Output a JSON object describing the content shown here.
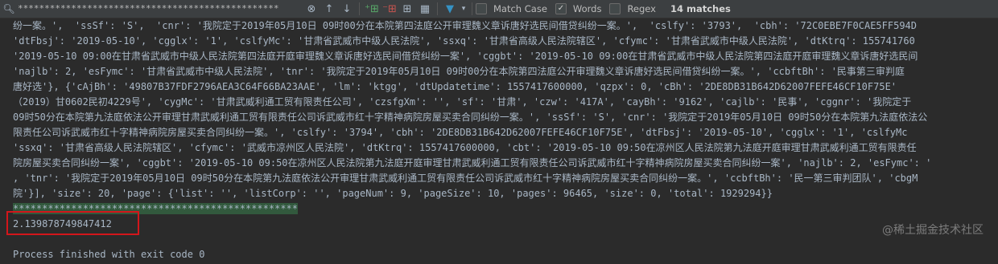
{
  "find_bar": {
    "query": "*************************************************",
    "options": [
      {
        "label": "Match Case",
        "checked": false
      },
      {
        "label": "Words",
        "checked": true
      },
      {
        "label": "Regex",
        "checked": false
      }
    ],
    "match_count": "14 matches"
  },
  "console": {
    "lines": [
      "纷一案。',  'ssSf': 'S',  'cnr': '我院定于2019年05月10日 09时00分在本院第四法庭公开审理魏义章诉唐好选民间借贷纠纷一案。',  'cslfy': '3793',  'cbh': '72C0EBE7F0CAE5FF594D",
      "'dtFbsj': '2019-05-10', 'cgglx': '1', 'cslfyMc': '甘肃省武威市中级人民法院', 'ssxq': '甘肃省高级人民法院辖区', 'cfymc': '甘肃省武威市中级人民法院', 'dtKtrq': 155741760",
      "'2019-05-10 09:00在甘肃省武威市中级人民法院第四法庭开庭审理魏义章诉唐好选民间借贷纠纷一案', 'cggbt': '2019-05-10 09:00在甘肃省武威市中级人民法院第四法庭开庭审理魏义章诉唐好选民间",
      "'najlb': 2, 'esFymc': '甘肃省武威市中级人民法院', 'tnr': '我院定于2019年05月10日 09时00分在本院第四法庭公开审理魏义章诉唐好选民间借贷纠纷一案。', 'ccbftBh': '民事第三审判庭",
      "唐好选'}, {'cAjBh': '49807B37FDF2796AEA3C64F66BA23AAE', 'lm': 'ktgg', 'dtUpdatetime': 1557417600000, 'qzpx': 0, 'cBh': '2DE8DB31B642D62007FEFE46CF10F75E'",
      "（2019）甘0602民初4229号', 'cygMc': '甘肃武威利通工贸有限责任公司', 'czsfgXm': '', 'sf': '甘肃', 'czw': '417A', 'cayBh': '9162', 'cajlb': '民事', 'cggnr': '我院定于",
      "09时50分在本院第九法庭依法公开审理甘肃武威利通工贸有限责任公司诉武威市红十字精神病院房屋买卖合同纠纷一案。', 'ssSf': 'S', 'cnr': '我院定于2019年05月10日 09时50分在本院第九法庭依法公",
      "限责任公司诉武威市红十字精神病院房屋买卖合同纠纷一案。', 'cslfy': '3794', 'cbh': '2DE8DB31B642D62007FEFE46CF10F75E', 'dtFbsj': '2019-05-10', 'cgglx': '1', 'cslfyMc",
      "'ssxq': '甘肃省高级人民法院辖区', 'cfymc': '武威市凉州区人民法院', 'dtKtrq': 1557417600000, 'cbt': '2019-05-10 09:50在凉州区人民法院第九法庭开庭审理甘肃武威利通工贸有限责任",
      "院房屋买卖合同纠纷一案', 'cggbt': '2019-05-10 09:50在凉州区人民法院第九法庭开庭审理甘肃武威利通工贸有限责任公司诉武威市红十字精神病院房屋买卖合同纠纷一案', 'najlb': 2, 'esFymc': '",
      ", 'tnr': '我院定于2019年05月10日 09时50分在本院第九法庭依法公开审理甘肃武威利通工贸有限责任公司诉武威市红十字精神病院房屋买卖合同纠纷一案。', 'ccbftBh': '民一第三审判团队', 'cbgM",
      "院'}], 'size': 20, 'page': {'list': '', 'listCorp': '', 'pageNum': 9, 'pageSize': 10, 'pages': 96465, 'size': 0, 'total': 1929294}}",
      "*************************************************",
      "2.139878749847412",
      "",
      "Process finished with exit code 0"
    ]
  },
  "watermark": "@稀土掘金技术社区"
}
